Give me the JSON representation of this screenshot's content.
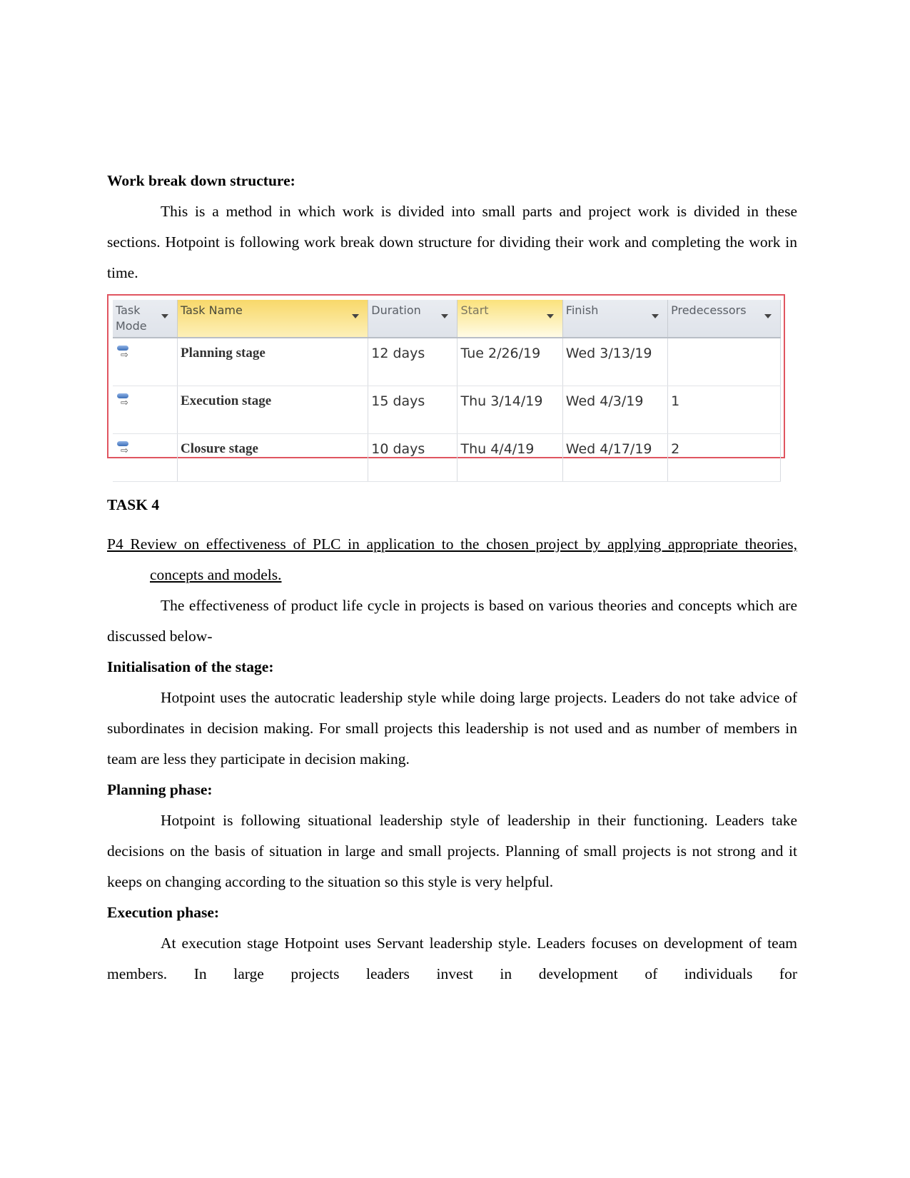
{
  "sections": {
    "wbs_heading": "Work break down structure:",
    "wbs_paragraph": "This is a method in which work is divided into small parts and project work is divided in these sections. Hotpoint is following work break down structure for dividing their work and completing the work in time.",
    "task_heading": "TASK 4",
    "p4_title": "P4 Review on effectiveness of PLC in application to the chosen project by applying appropriate theories, concepts and models.",
    "intro_paragraph": "The effectiveness of product life cycle in projects is based on various theories and concepts which are discussed below-",
    "init_heading": "Initialisation of the stage:",
    "init_paragraph": "Hotpoint uses the autocratic leadership style while doing large projects. Leaders do not take advice of subordinates in decision making. For small projects this leadership is not used and as number of members in team are less they participate in decision making.",
    "planning_heading": "Planning phase:",
    "planning_paragraph": "Hotpoint is following situational leadership style of leadership in their functioning. Leaders take decisions on the basis of situation in large and small projects. Planning of small projects is not strong and it keeps on changing according to the situation so this style is very helpful.",
    "execution_heading": "Execution phase:",
    "execution_paragraph": "At execution stage Hotpoint uses Servant leadership style. Leaders  focuses on development of team members. In large projects leaders invest in development of individuals for"
  },
  "wbs_table": {
    "columns": [
      "Task Mode",
      "Task Name",
      "Duration",
      "Start",
      "Finish",
      "Predecessors"
    ],
    "task_mode_icon": "auto-scheduled-task-icon",
    "rows": [
      {
        "name": "Planning stage",
        "duration": "12 days",
        "start": "Tue 2/26/19",
        "finish": "Wed 3/13/19",
        "predecessors": ""
      },
      {
        "name": "Execution stage",
        "duration": "15 days",
        "start": "Thu 3/14/19",
        "finish": "Wed 4/3/19",
        "predecessors": "1"
      },
      {
        "name": "Closure stage",
        "duration": "10 days",
        "start": "Thu 4/4/19",
        "finish": "Wed 4/17/19",
        "predecessors": "2"
      }
    ]
  },
  "colors": {
    "table_border": "#e05560",
    "highlight_header": "#f8d86a"
  }
}
